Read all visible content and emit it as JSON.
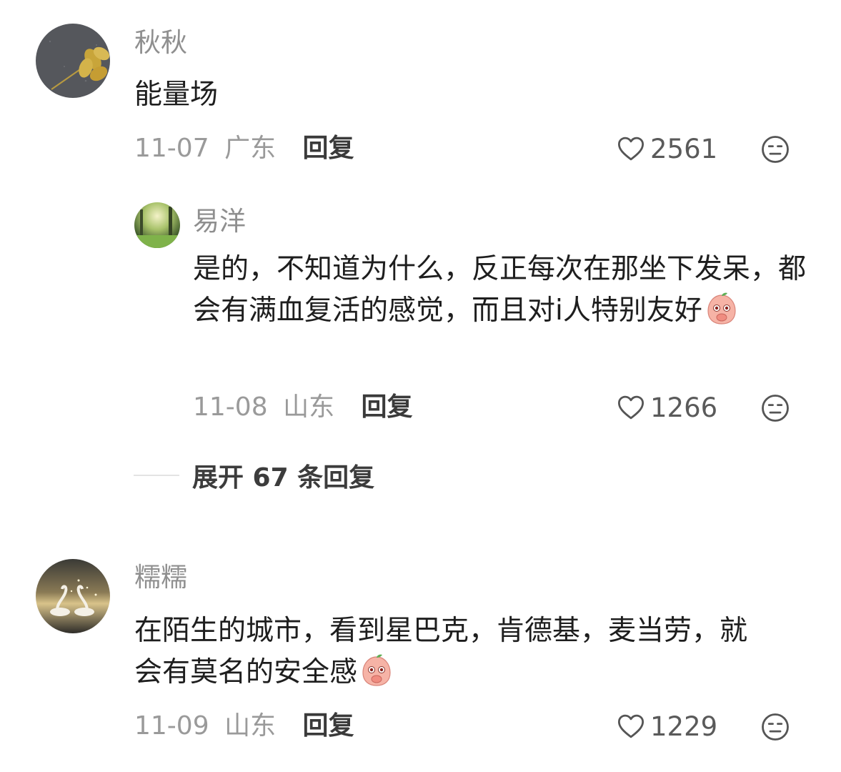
{
  "comments": [
    {
      "username": "秋秋",
      "text": "能量场",
      "date": "11-07",
      "location": "广东",
      "reply_label": "回复",
      "likes": "2561",
      "avatar_icon": "leaf-on-asphalt-avatar"
    },
    {
      "username": "易洋",
      "text": "是的，不知道为什么，反正每次在那坐下发呆，都会有满血复活的感觉，而且对i人特别友好",
      "date": "11-08",
      "location": "山东",
      "reply_label": "回复",
      "likes": "1266",
      "avatar_icon": "forest-sunlight-avatar",
      "emoji": "peach-shy-emoji"
    },
    {
      "username": "糯糯",
      "text": "在陌生的城市，看到星巴克，肯德基，麦当劳，就会有莫名的安全感",
      "date": "11-09",
      "location": "山东",
      "reply_label": "回复",
      "likes": "1229",
      "avatar_icon": "swans-lake-avatar",
      "emoji": "peach-shy-emoji"
    }
  ],
  "expand_replies": "展开 67 条回复",
  "colors": {
    "username": "#8f8f8f",
    "text": "#1e1e1e",
    "meta": "#9a9a9a",
    "reply": "#3a3a3a"
  }
}
